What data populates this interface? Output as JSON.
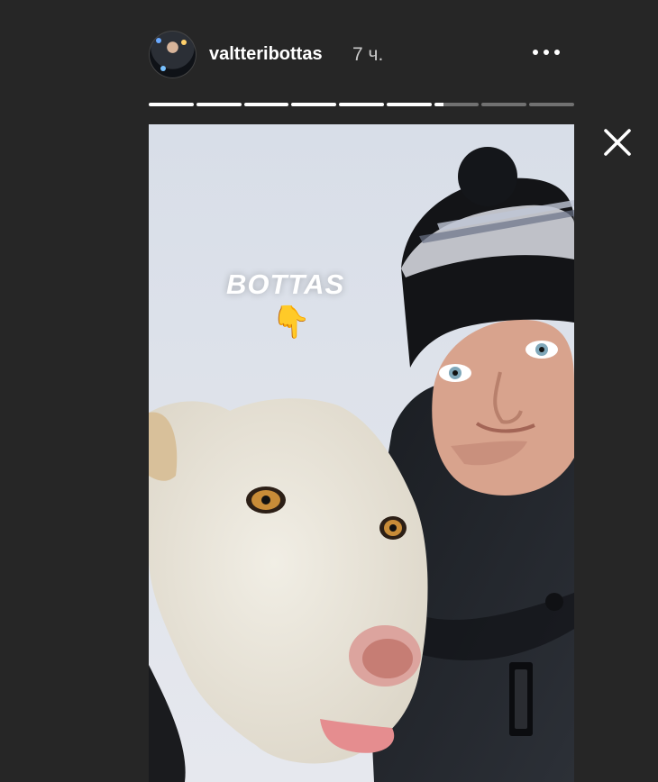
{
  "story": {
    "username": "valtteribottas",
    "time": "7 ч.",
    "sticker_text": "BOTTAS",
    "sticker_emoji": "👇",
    "progress": {
      "segments": 9,
      "completed": 6,
      "current_fraction": 0.2
    }
  },
  "icons": {
    "more": "more-options-icon",
    "close": "close-icon"
  }
}
